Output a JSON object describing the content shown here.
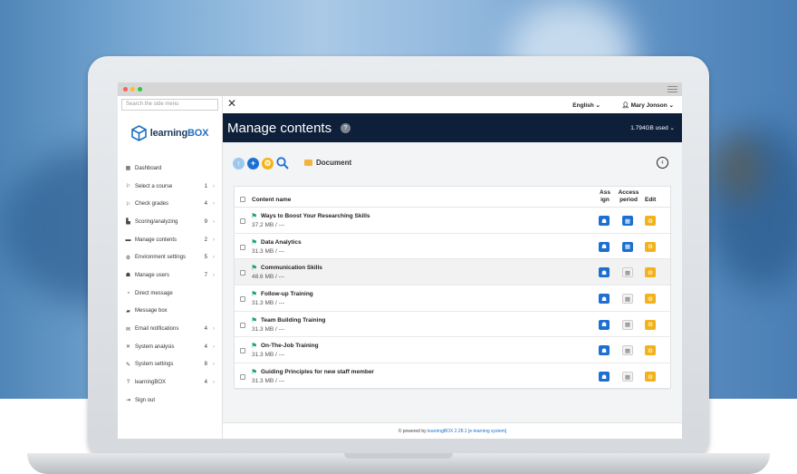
{
  "colors": {
    "header_bg": "#0e1f3a",
    "accent_blue": "#1d6fd1",
    "edit_yellow": "#f3b21b",
    "flag_green": "#1fa37a",
    "traffic_red": "#ff5f57",
    "traffic_yellow": "#febc2e",
    "traffic_green": "#28c840"
  },
  "sidebar": {
    "search_placeholder": "Search the side menu",
    "logo": {
      "part1": "learning",
      "part2": "BOX"
    },
    "items": [
      {
        "icon": "grid-icon",
        "glyph": "▦",
        "label": "Dashboard",
        "count": "",
        "arrow": ""
      },
      {
        "icon": "flag-icon",
        "glyph": "⚐",
        "label": "Select a course",
        "count": "1",
        "arrow": "›"
      },
      {
        "icon": "flag-icon",
        "glyph": "⚐",
        "label": "Check grades",
        "count": "4",
        "arrow": "›"
      },
      {
        "icon": "file-icon",
        "glyph": "▙",
        "label": "Scoring/analyzing",
        "count": "9",
        "arrow": "›"
      },
      {
        "icon": "folder-icon",
        "glyph": "▬",
        "label": "Manage contents",
        "count": "2",
        "arrow": "›"
      },
      {
        "icon": "gear-icon",
        "glyph": "⚙",
        "label": "Environment settings",
        "count": "5",
        "arrow": "›"
      },
      {
        "icon": "users-icon",
        "glyph": "☗",
        "label": "Manage users",
        "count": "7",
        "arrow": "›"
      },
      {
        "icon": "message-icon",
        "glyph": "◔",
        "label": "Direct message",
        "count": "",
        "arrow": ""
      },
      {
        "icon": "chat-icon",
        "glyph": "▰",
        "label": "Message box",
        "count": "",
        "arrow": ""
      },
      {
        "icon": "mail-icon",
        "glyph": "✉",
        "label": "Email notifications",
        "count": "4",
        "arrow": "›"
      },
      {
        "icon": "chart-icon",
        "glyph": "✕",
        "label": "System analysis",
        "count": "4",
        "arrow": "›"
      },
      {
        "icon": "wrench-icon",
        "glyph": "✎",
        "label": "System settings",
        "count": "8",
        "arrow": "›"
      },
      {
        "icon": "question-icon",
        "glyph": "?",
        "label": "learningBOX",
        "count": "4",
        "arrow": "›"
      },
      {
        "icon": "signout-icon",
        "glyph": "⇥",
        "label": "Sign out",
        "count": "",
        "arrow": ""
      }
    ]
  },
  "topbar": {
    "language": "English ⌄",
    "user": "Mary Jonson ⌄"
  },
  "header": {
    "title": "Manage contents",
    "help": "?",
    "storage": "1.794GB used ⌄"
  },
  "toolbar": {
    "folder": "Document",
    "back": "‹"
  },
  "table": {
    "headers": {
      "name": "Content name",
      "assign": "Ass ign",
      "access": "Access period",
      "edit": "Edit"
    },
    "rows": [
      {
        "title": "Ways to Boost Your Researching Skills",
        "size": "37.2 MB / ---",
        "access": "on",
        "highlight": false
      },
      {
        "title": "Data Analytics",
        "size": "31.3 MB / ---",
        "access": "on",
        "highlight": false
      },
      {
        "title": "Communication Skills",
        "size": "48.6 MB / ---",
        "access": "off",
        "highlight": true
      },
      {
        "title": "Follow-up Training",
        "size": "31.3 MB / ---",
        "access": "off",
        "highlight": false
      },
      {
        "title": "Team Building Training",
        "size": "31.3 MB / ---",
        "access": "off",
        "highlight": false
      },
      {
        "title": "On-The-Job Training",
        "size": "31.3 MB / ---",
        "access": "off",
        "highlight": false
      },
      {
        "title": "Guiding Principles for new staff member",
        "size": "31.3 MB / ---",
        "access": "off",
        "highlight": false
      }
    ]
  },
  "footer": {
    "prefix": "© powered by ",
    "link": "learningBOX 2.28.1 [e-learning system]"
  }
}
